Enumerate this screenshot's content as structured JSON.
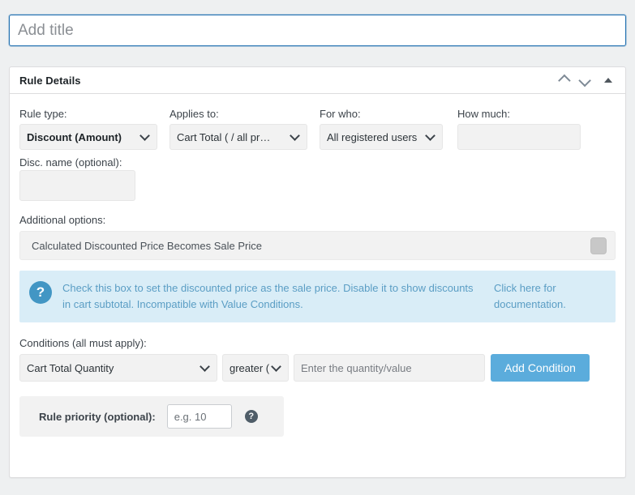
{
  "title": {
    "placeholder": "Add title",
    "value": ""
  },
  "panel": {
    "heading": "Rule Details",
    "actions": {
      "move_up": "▲",
      "move_down": "▼",
      "toggle": "▲"
    }
  },
  "fields": {
    "rule_type": {
      "label": "Rule type:",
      "value": "Discount (Amount)"
    },
    "applies_to": {
      "label": "Applies to:",
      "value": "Cart Total ( / all pr…"
    },
    "for_who": {
      "label": "For who:",
      "value": "All registered users"
    },
    "how_much": {
      "label": "How much:",
      "value": "",
      "placeholder": ""
    },
    "disc_name": {
      "label": "Disc. name (optional):",
      "value": "",
      "placeholder": ""
    }
  },
  "additional_options": {
    "label": "Additional options:",
    "option_text": "Calculated Discounted Price Becomes Sale Price",
    "checked": false
  },
  "banner": {
    "icon": "?",
    "text": "Check this box to set the discounted price as the sale price. Disable it to show discounts in cart subtotal. Incompatible with Value Conditions.",
    "link_text": "Click here for documentation.",
    "background_color": "#d9edf7",
    "text_color": "#5a9dc4",
    "icon_color": "#4296c4"
  },
  "conditions": {
    "label": "Conditions (all must apply):",
    "condition_type": "Cart Total Quantity",
    "operator": "greater (",
    "value": "",
    "value_placeholder": "Enter the quantity/value",
    "add_button": "Add Condition",
    "add_button_color": "#5bacdc"
  },
  "priority": {
    "label": "Rule priority (optional):",
    "value": "",
    "placeholder": "e.g. 10",
    "help": "?"
  }
}
